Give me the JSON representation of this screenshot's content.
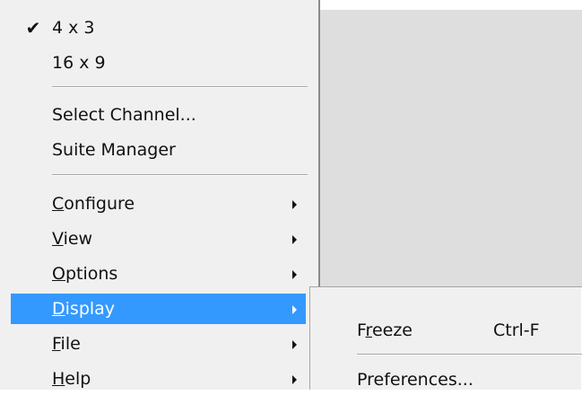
{
  "main_menu": {
    "aspect_items": [
      {
        "label": "4 x 3",
        "checked": true,
        "check_glyph": "✔"
      },
      {
        "label": "16 x 9",
        "checked": false
      }
    ],
    "channel_items": [
      {
        "label": "Select Channel..."
      },
      {
        "label": "Suite Manager"
      }
    ],
    "submenus": [
      {
        "label_prefix": "",
        "mnemonic": "C",
        "label_suffix": "onfigure",
        "has_submenu": true
      },
      {
        "label_prefix": "",
        "mnemonic": "V",
        "label_suffix": "iew",
        "has_submenu": true
      },
      {
        "label_prefix": "",
        "mnemonic": "O",
        "label_suffix": "ptions",
        "has_submenu": true
      },
      {
        "label_prefix": "",
        "mnemonic": "D",
        "label_suffix": "isplay",
        "has_submenu": true,
        "selected": true
      },
      {
        "label_prefix": "",
        "mnemonic": "F",
        "label_suffix": "ile",
        "has_submenu": true
      },
      {
        "label_prefix": "",
        "mnemonic": "H",
        "label_suffix": "elp",
        "has_submenu": true
      }
    ]
  },
  "display_submenu": {
    "items": [
      {
        "label_prefix": "F",
        "mnemonic": "r",
        "label_suffix": "eeze",
        "shortcut": "Ctrl-F"
      },
      {
        "label": "Preferences..."
      }
    ]
  },
  "colors": {
    "menu_background": "#f0f0f0",
    "selection": "#3399ff",
    "background_area": "#dedede"
  }
}
